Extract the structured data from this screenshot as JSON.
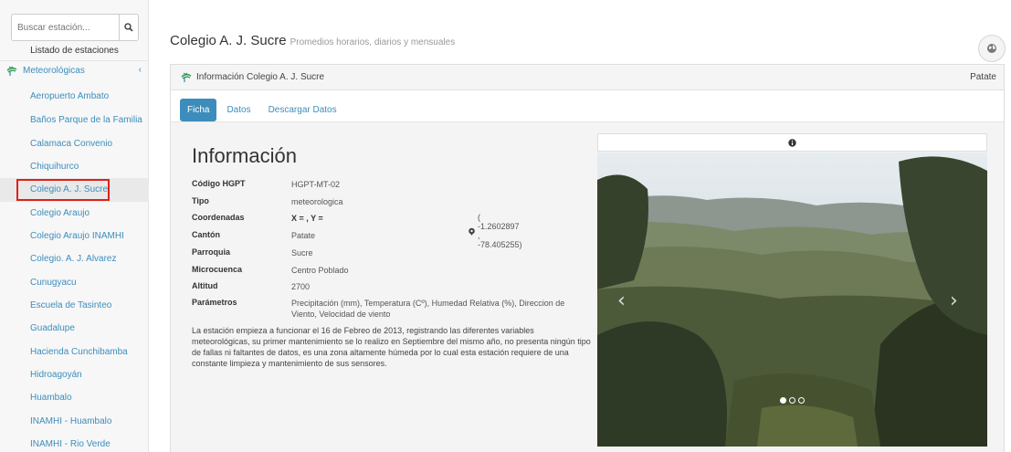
{
  "sidebar": {
    "search_placeholder": "Buscar estación...",
    "list_title": "Listado de estaciones",
    "category_label": "Meteorológicas",
    "stations": [
      "Aeropuerto Ambato",
      "Baños Parque de la Familia",
      "Calamaca Convenio",
      "Chiquihurco",
      "Colegio A. J. Sucre",
      "Colegio Araujo",
      "Colegio Araujo INAMHI",
      "Colegio. A. J. Alvarez",
      "Cunugyacu",
      "Escuela de Tasinteo",
      "Guadalupe",
      "Hacienda Cunchibamba",
      "Hidroagoyán",
      "Huambalo",
      "INAMHI - Huambalo",
      "INAMHI - Rio Verde"
    ],
    "selected_station_index": 4
  },
  "header": {
    "title": "Colegio A. J. Sucre",
    "subtitle": "Promedios horarios, diarios y mensuales"
  },
  "panel": {
    "heading": "Información Colegio A. J. Sucre",
    "location": "Patate",
    "tabs": [
      "Ficha",
      "Datos",
      "Descargar Datos"
    ],
    "active_tab": "Ficha"
  },
  "info": {
    "title": "Información",
    "rows": [
      {
        "key": "Código HGPT",
        "value": "HGPT-MT-02"
      },
      {
        "key": "Tipo",
        "value": "meteorologica"
      },
      {
        "key": "Coordenadas",
        "value": "X = , Y ="
      },
      {
        "key": "Cantón",
        "value": "Patate"
      },
      {
        "key": "Parroquia",
        "value": "Sucre"
      },
      {
        "key": "Microcuenca",
        "value": "Centro Poblado"
      },
      {
        "key": "Altitud",
        "value": "2700"
      },
      {
        "key": "Parámetros",
        "value": "Precipitación (mm), Temperatura (Cº), Humedad Relativa (%), Direccion de Viento, Velocidad de viento"
      }
    ],
    "coordinates_text": "( -1.2602897 , -78.405255)",
    "description": "La estación empieza a funcionar el 16 de Febreo de 2013, registrando las diferentes variables meteorológicas, su primer mantenimiento se lo realizo en Septiembre del mismo año, no presenta ningún tipo de fallas ni faltantes de datos, es una zona altamente húmeda por lo cual esta estación requiere de una constante limpieza y mantenimiento de sus sensores."
  },
  "carousel": {
    "slide_count": 3,
    "active_slide": 1
  },
  "colors": {
    "link": "#3c8dbc",
    "highlight_border": "#e0201b",
    "tab_active_bg": "#3c8dbc"
  }
}
